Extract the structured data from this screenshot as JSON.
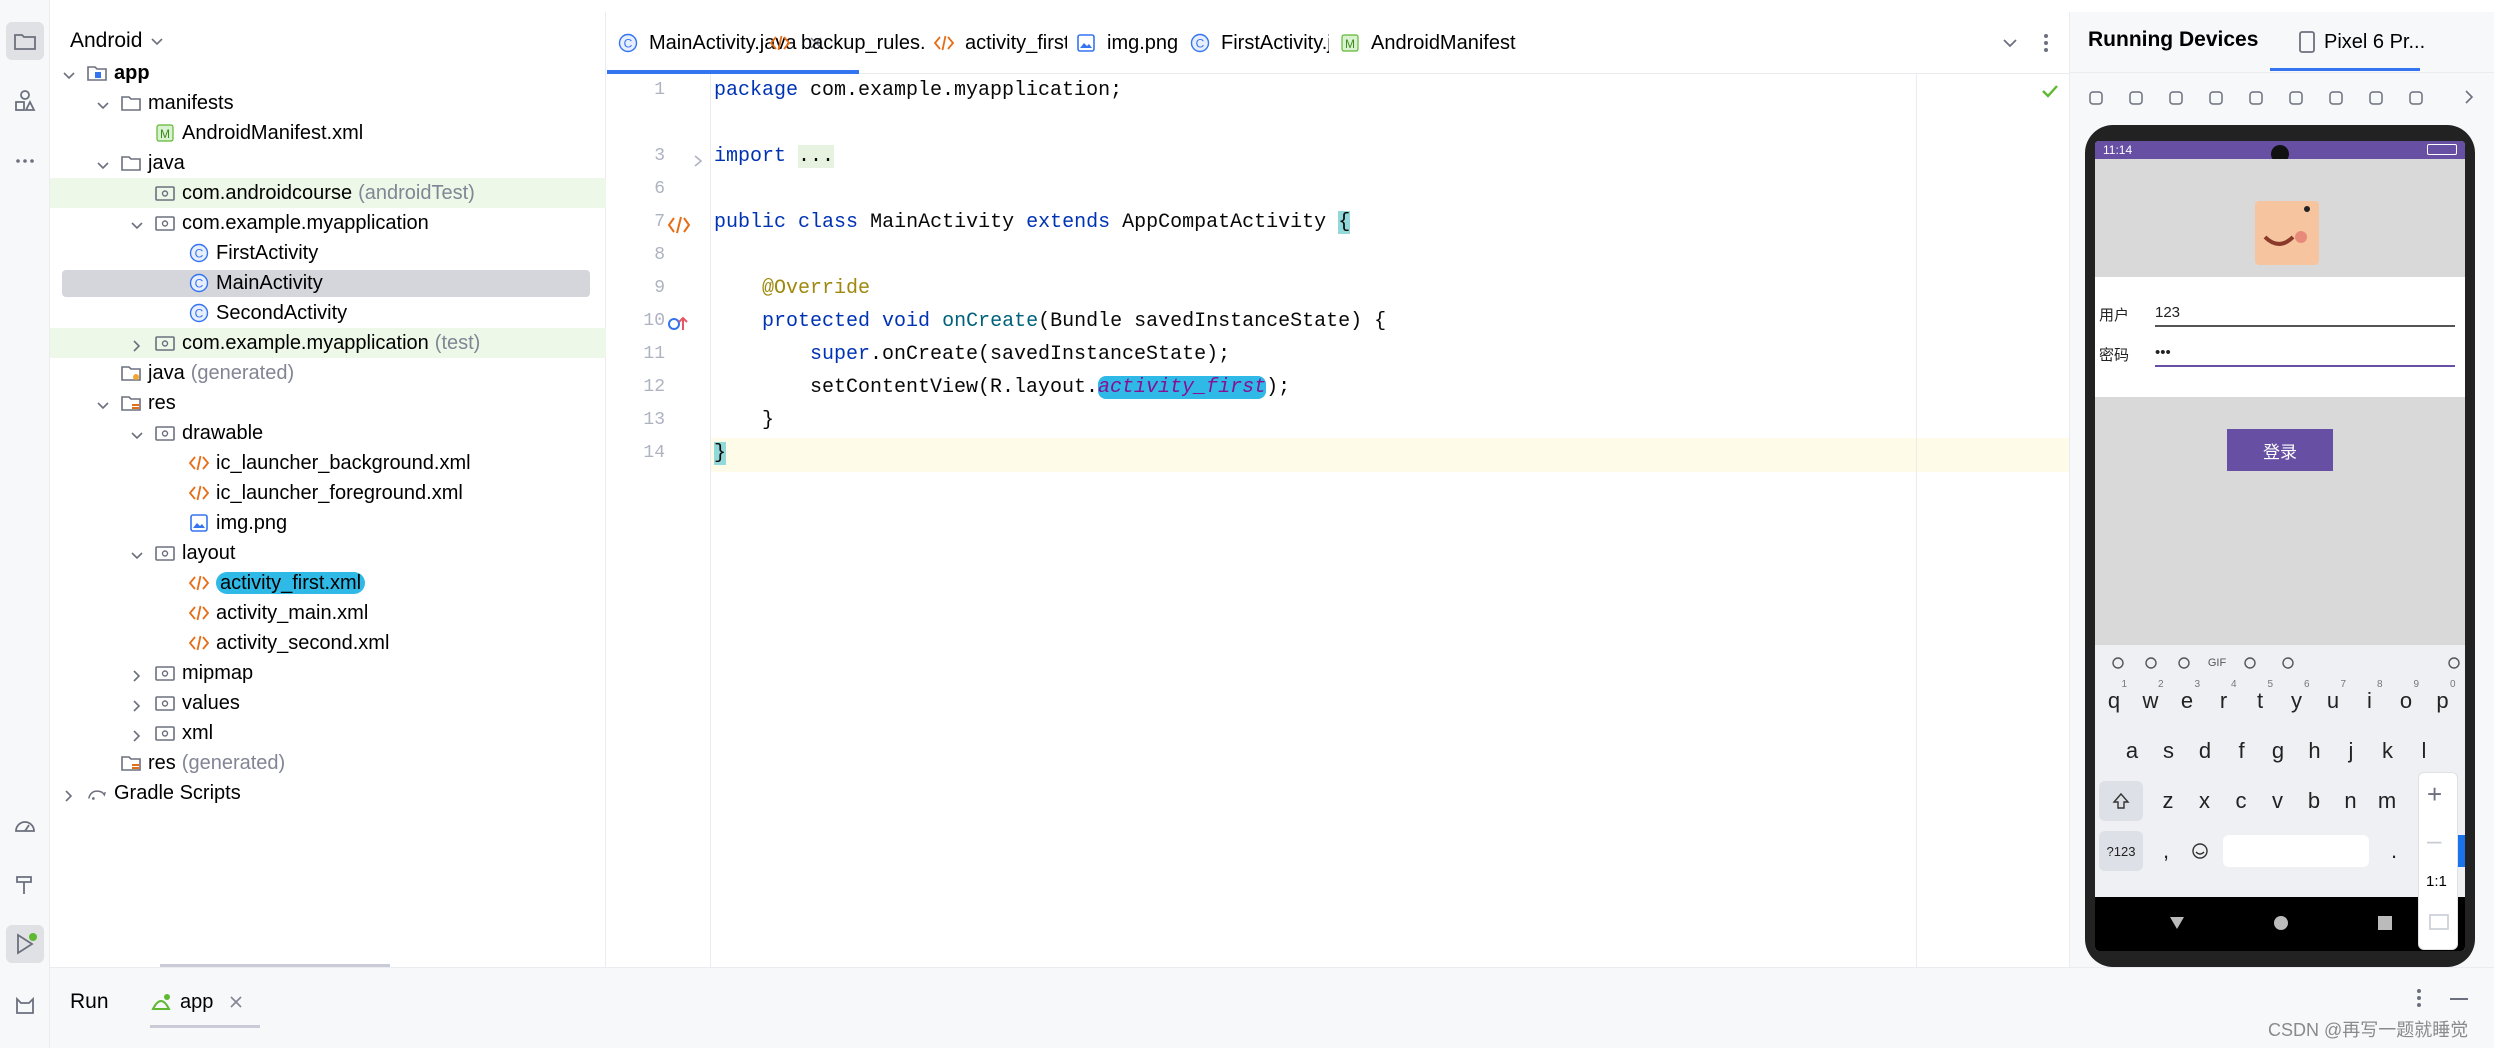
{
  "project": {
    "view_selector": "Android",
    "tree": [
      {
        "label": "app",
        "suffix": "",
        "depth": 0,
        "icon": "module-icon",
        "chevron": "down",
        "bold": true
      },
      {
        "label": "manifests",
        "suffix": "",
        "depth": 1,
        "icon": "folder-icon",
        "chevron": "down"
      },
      {
        "label": "AndroidManifest.xml",
        "suffix": "",
        "depth": 2,
        "icon": "manifest-icon",
        "chevron": ""
      },
      {
        "label": "java",
        "suffix": "",
        "depth": 1,
        "icon": "folder-icon",
        "chevron": "down"
      },
      {
        "label": "com.androidcourse",
        "suffix": "(androidTest)",
        "depth": 2,
        "icon": "package-icon",
        "chevron": "",
        "bg": "#eef8e8"
      },
      {
        "label": "com.example.myapplication",
        "suffix": "",
        "depth": 2,
        "icon": "package-icon",
        "chevron": "down"
      },
      {
        "label": "FirstActivity",
        "suffix": "",
        "depth": 3,
        "icon": "class-icon",
        "chevron": ""
      },
      {
        "label": "MainActivity",
        "suffix": "",
        "depth": 3,
        "icon": "class-icon",
        "chevron": "",
        "selected": true
      },
      {
        "label": "SecondActivity",
        "suffix": "",
        "depth": 3,
        "icon": "class-icon",
        "chevron": ""
      },
      {
        "label": "com.example.myapplication",
        "suffix": "(test)",
        "depth": 2,
        "icon": "package-icon",
        "chevron": "right",
        "bg": "#eef8e8"
      },
      {
        "label": "java",
        "suffix": "(generated)",
        "depth": 1,
        "icon": "folder-gen-icon",
        "chevron": "",
        "gray": true
      },
      {
        "label": "res",
        "suffix": "",
        "depth": 1,
        "icon": "res-folder-icon",
        "chevron": "down"
      },
      {
        "label": "drawable",
        "suffix": "",
        "depth": 2,
        "icon": "package-icon",
        "chevron": "down"
      },
      {
        "label": "ic_launcher_background.xml",
        "suffix": "",
        "depth": 3,
        "icon": "xml-icon",
        "chevron": ""
      },
      {
        "label": "ic_launcher_foreground.xml",
        "suffix": "",
        "depth": 3,
        "icon": "xml-icon",
        "chevron": ""
      },
      {
        "label": "img.png",
        "suffix": "",
        "depth": 3,
        "icon": "image-icon",
        "chevron": ""
      },
      {
        "label": "layout",
        "suffix": "",
        "depth": 2,
        "icon": "package-icon",
        "chevron": "down"
      },
      {
        "label": "activity_first.xml",
        "suffix": "",
        "depth": 3,
        "icon": "xml-icon",
        "chevron": "",
        "highlight": true
      },
      {
        "label": "activity_main.xml",
        "suffix": "",
        "depth": 3,
        "icon": "xml-icon",
        "chevron": ""
      },
      {
        "label": "activity_second.xml",
        "suffix": "",
        "depth": 3,
        "icon": "xml-icon",
        "chevron": ""
      },
      {
        "label": "mipmap",
        "suffix": "",
        "depth": 2,
        "icon": "package-icon",
        "chevron": "right"
      },
      {
        "label": "values",
        "suffix": "",
        "depth": 2,
        "icon": "package-icon",
        "chevron": "right"
      },
      {
        "label": "xml",
        "suffix": "",
        "depth": 2,
        "icon": "package-icon",
        "chevron": "right"
      },
      {
        "label": "res",
        "suffix": "(generated)",
        "depth": 1,
        "icon": "res-folder-icon",
        "chevron": "",
        "gray": true
      },
      {
        "label": "Gradle Scripts",
        "suffix": "",
        "depth": 0,
        "icon": "gradle-icon",
        "chevron": "right"
      }
    ]
  },
  "editor": {
    "tabs": [
      {
        "label": "MainActivity.java",
        "icon": "class-icon",
        "active": true,
        "closable": true
      },
      {
        "label": "backup_rules.xml",
        "icon": "xml-icon"
      },
      {
        "label": "activity_first.xml",
        "icon": "xml-icon"
      },
      {
        "label": "img.png",
        "icon": "image-icon"
      },
      {
        "label": "FirstActivity.java",
        "icon": "class-icon"
      },
      {
        "label": "AndroidManifest",
        "icon": "manifest-icon"
      }
    ],
    "line_numbers": [
      "1",
      "3",
      "6",
      "7",
      "8",
      "9",
      "10",
      "11",
      "12",
      "13",
      "14"
    ],
    "code": {
      "l1_kw": "package",
      "l1_rest": " com.example.myapplication;",
      "l3_kw": "import",
      "l3_fold": "...",
      "l7_public": "public",
      "l7_class": "class",
      "l7_name": "MainActivity",
      "l7_extends": "extends",
      "l7_base": "AppCompatActivity",
      "l7_brace": "{",
      "l9_annotation": "@Override",
      "l10_protected": "protected",
      "l10_void": "void",
      "l10_method": "onCreate",
      "l10_params": "(Bundle savedInstanceState) {",
      "l11_super": "super",
      "l11_rest": ".onCreate(savedInstanceState);",
      "l12_pre": "setContentView(R.layout.",
      "l12_field": "activity_first",
      "l12_post": ");",
      "l13": "}",
      "l14": "}"
    }
  },
  "running_devices": {
    "title": "Running Devices",
    "device_tab": "Pixel 6 Pr...",
    "status_time": "11:14",
    "form": {
      "user_label": "用户",
      "user_value": "123",
      "password_label": "密码",
      "password_value": "•••",
      "login_button": "登录"
    },
    "keyboard": {
      "row1": [
        [
          "q",
          "1"
        ],
        [
          "w",
          "2"
        ],
        [
          "e",
          "3"
        ],
        [
          "r",
          "4"
        ],
        [
          "t",
          "5"
        ],
        [
          "y",
          "6"
        ],
        [
          "u",
          "7"
        ],
        [
          "i",
          "8"
        ],
        [
          "o",
          "9"
        ],
        [
          "p",
          "0"
        ]
      ],
      "row2": [
        "a",
        "s",
        "d",
        "f",
        "g",
        "h",
        "j",
        "k",
        "l"
      ],
      "row3": [
        "z",
        "x",
        "c",
        "v",
        "b",
        "n",
        "m"
      ],
      "sym_key": "?123",
      "comma": ",",
      "period": ".",
      "gif_label": "GIF"
    },
    "zoom_label": "1:1"
  },
  "bottom": {
    "run_label": "Run",
    "app_tab": "app"
  },
  "watermark": "CSDN @再写一题就睡觉",
  "colors": {
    "accent": "#3574f0",
    "highlight": "#2fb9e7",
    "login_button": "#6750a4",
    "phone_statusbar": "#6750a4"
  }
}
